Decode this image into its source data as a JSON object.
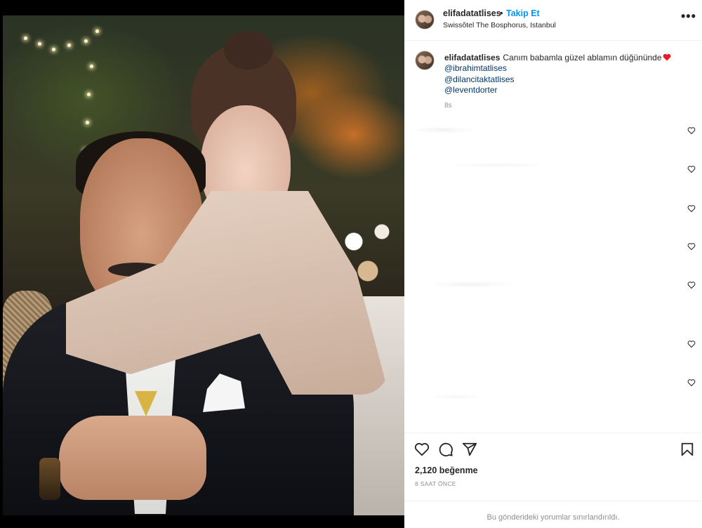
{
  "post": {
    "username": "elifadatatlises",
    "follow_label": "Takip Et",
    "separator": "•",
    "location": "Swissôtel The Bosphorus, Istanbul",
    "more_label": "•••"
  },
  "caption": {
    "username": "elifadatatlises",
    "text": "Canım babamla güzel ablamın düğününde",
    "mentions": [
      "@ibrahimtatlises",
      "@dilancitaktatlises",
      "@leventdorter"
    ],
    "time": "8s"
  },
  "stats": {
    "likes": "2,120 beğenme",
    "time_ago": "8 SAAT ÖNCE"
  },
  "footer": {
    "comments_disabled": "Bu gönderideki yorumlar sınırlandırıldı."
  },
  "icons": {
    "like": "heart-icon",
    "comment": "comment-icon",
    "share": "share-icon",
    "save": "bookmark-icon",
    "more": "more-icon",
    "emoji": "red-heart-emoji"
  },
  "colors": {
    "link_blue": "#0095f6",
    "mention": "#00376b",
    "muted": "#8e8e8e",
    "heart_red": "#ed1c24"
  }
}
